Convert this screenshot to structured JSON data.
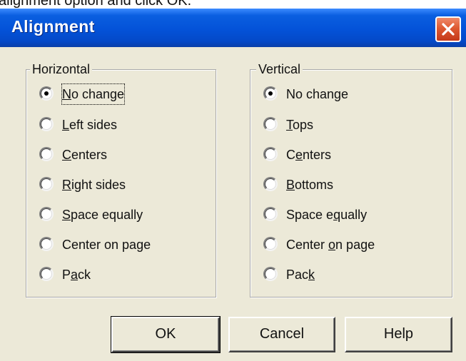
{
  "caption": "alignment option and click OK.",
  "dialog": {
    "title": "Alignment",
    "close_icon": "close-x-icon"
  },
  "horizontal": {
    "legend": "Horizontal",
    "selected": "No change",
    "options": [
      {
        "pre": "",
        "key": "N",
        "post": "o change",
        "checked": true
      },
      {
        "pre": "",
        "key": "L",
        "post": "eft sides",
        "checked": false
      },
      {
        "pre": "",
        "key": "C",
        "post": "enters",
        "checked": false
      },
      {
        "pre": "",
        "key": "R",
        "post": "ight sides",
        "checked": false
      },
      {
        "pre": "",
        "key": "S",
        "post": "pace equally",
        "checked": false
      },
      {
        "pre": "Center on page",
        "key": "",
        "post": "",
        "checked": false
      },
      {
        "pre": "P",
        "key": "a",
        "post": "ck",
        "checked": false
      }
    ]
  },
  "vertical": {
    "legend": "Vertical",
    "selected": "No change",
    "options": [
      {
        "pre": "No change",
        "key": "",
        "post": "",
        "checked": true
      },
      {
        "pre": "",
        "key": "T",
        "post": "ops",
        "checked": false
      },
      {
        "pre": "C",
        "key": "e",
        "post": "nters",
        "checked": false
      },
      {
        "pre": "",
        "key": "B",
        "post": "ottoms",
        "checked": false
      },
      {
        "pre": "Space e",
        "key": "q",
        "post": "ually",
        "checked": false
      },
      {
        "pre": "Center ",
        "key": "o",
        "post": "n page",
        "checked": false
      },
      {
        "pre": "Pac",
        "key": "k",
        "post": "",
        "checked": false
      }
    ]
  },
  "buttons": {
    "ok": "OK",
    "cancel": "Cancel",
    "help": "Help"
  }
}
